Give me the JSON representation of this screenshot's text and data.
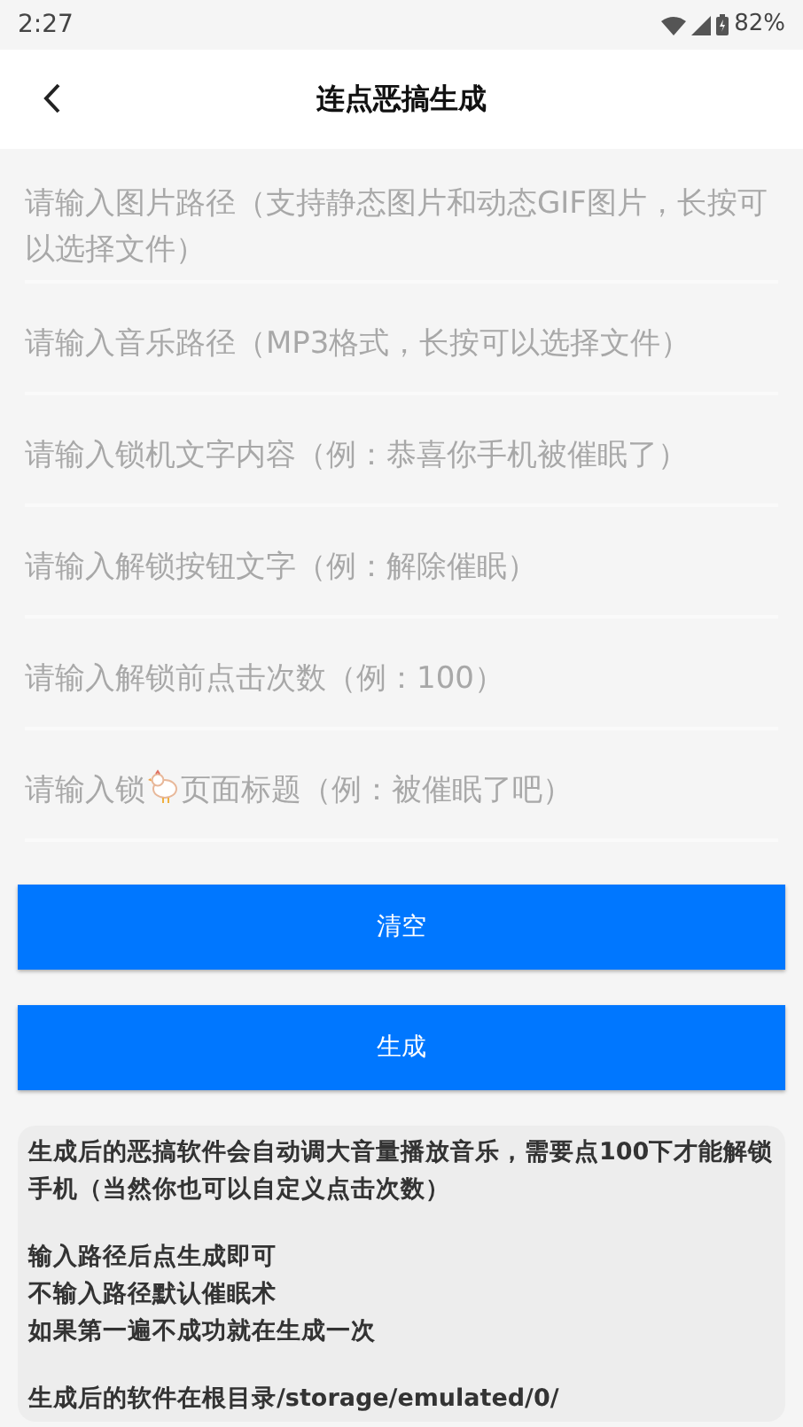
{
  "status_bar": {
    "time": "2:27",
    "battery": "82%"
  },
  "header": {
    "title": "连点恶搞生成"
  },
  "fields": [
    {
      "kind": "text",
      "placeholder": "请输入图片路径（支持静态图片和动态GIF图片，长按可以选择文件）"
    },
    {
      "kind": "text",
      "placeholder": "请输入音乐路径（MP3格式，长按可以选择文件）"
    },
    {
      "kind": "text",
      "placeholder": "请输入锁机文字内容（例：恭喜你手机被催眠了）"
    },
    {
      "kind": "text",
      "placeholder": "请输入解锁按钮文字（例：解除催眠）"
    },
    {
      "kind": "text",
      "placeholder": "请输入解锁前点击次数（例：100）"
    },
    {
      "kind": "icon",
      "placeholder_before": "请输入锁",
      "placeholder_after": "页面标题（例：被催眠了吧）"
    }
  ],
  "buttons": [
    "清空",
    "生成"
  ],
  "info": {
    "paragraphs": [
      [
        "生成后的恶搞软件会自动调大音量播放音乐，需要点100下才能解锁手机（当然你也可以自定义点击次数）"
      ],
      [
        "输入路径后点生成即可",
        "不输入路径默认催眠术",
        "如果第一遍不成功就在生成一次"
      ],
      [
        "生成后的软件在根目录/storage/emulated/0/"
      ]
    ]
  }
}
